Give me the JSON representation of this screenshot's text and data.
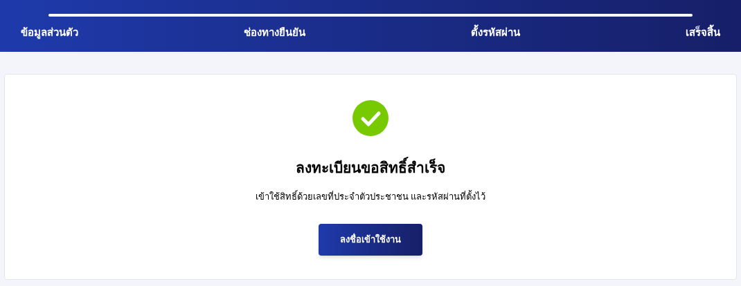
{
  "progress": {
    "level": 1
  },
  "steps": [
    "ข้อมูลส่วนตัว",
    "ช่องทางยืนยัน",
    "ตั้งรหัสผ่าน",
    "เสร็จสิ้น"
  ],
  "result": {
    "title": "ลงทะเบียนขอสิทธิ์สำเร็จ",
    "message": "เข้าใช้สิทธิ์ด้วยเลขที่ประจำตัวประชาชน และรหัสผ่านที่ตั้งไว้",
    "button": "ลงชื่อเข้าใช้งาน"
  }
}
